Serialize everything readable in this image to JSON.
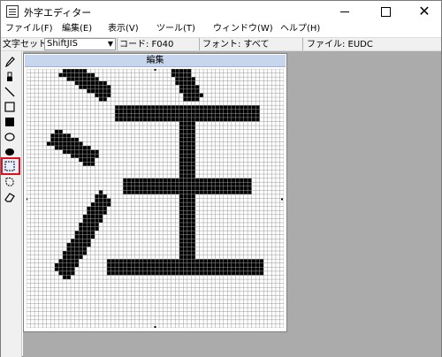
{
  "window": {
    "title": "外字エディター",
    "controls": {
      "minimize": "",
      "maximize": "",
      "close": "✕"
    }
  },
  "menu": [
    {
      "label": "ファイル(F)"
    },
    {
      "label": "編集(E)"
    },
    {
      "label": "表示(V)"
    },
    {
      "label": "ツール(T)"
    },
    {
      "label": "ウィンドウ(W)"
    },
    {
      "label": "ヘルプ(H)"
    }
  ],
  "status": {
    "charset_label": "文字セット:",
    "charset_value": "ShiftJIS",
    "code": "コード: F040",
    "font": "フォント: すべて",
    "file": "ファイル: EUDC"
  },
  "tools": [
    {
      "icon": "pencil-icon"
    },
    {
      "icon": "brush-icon"
    },
    {
      "icon": "line-icon"
    },
    {
      "icon": "hollow-rectangle-icon"
    },
    {
      "icon": "filled-rectangle-icon"
    },
    {
      "icon": "hollow-ellipse-icon"
    },
    {
      "icon": "filled-ellipse-icon"
    },
    {
      "icon": "rectangle-select-icon",
      "selected": true
    },
    {
      "icon": "freeform-select-icon"
    },
    {
      "icon": "eraser-icon"
    }
  ],
  "editor": {
    "header": "編集",
    "glyph": "注",
    "grid_size": 64
  },
  "colors": {
    "selected_tool_outline": "#e3101b",
    "editor_header_bg": "#c7d6ec",
    "workspace_bg": "#ababab"
  }
}
